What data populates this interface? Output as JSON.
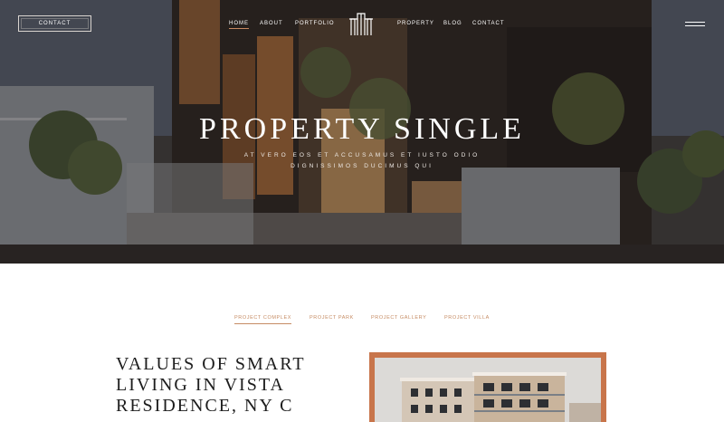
{
  "header": {
    "contact_label": "CONTACT",
    "nav": [
      {
        "label": "HOME",
        "active": true
      },
      {
        "label": "ABOUT",
        "active": false
      },
      {
        "label": "PORTFOLIO",
        "active": false
      },
      {
        "label": "PROPERTY",
        "active": false
      },
      {
        "label": "BLOG",
        "active": false
      },
      {
        "label": "CONTACT",
        "active": false
      }
    ],
    "logo_icon": "building-logo-icon",
    "menu_icon": "hamburger-icon"
  },
  "hero": {
    "title": "PROPERTY SINGLE",
    "subtitle_line1": "AT VERO EOS ET ACCUSAMUS ET IUSTO ODIO",
    "subtitle_line2": "DIGNISSIMOS DUCIMUS QUI"
  },
  "tabs": [
    {
      "label": "PROJECT COMPLEX",
      "active": true
    },
    {
      "label": "PROJECT PARK",
      "active": false
    },
    {
      "label": "PROJECT GALLERY",
      "active": false
    },
    {
      "label": "PROJECT VILLA",
      "active": false
    }
  ],
  "section": {
    "title_line1": "VALUES OF SMART",
    "title_line2": "LIVING IN VISTA",
    "title_line3": "RESIDENCE, NY C"
  },
  "colors": {
    "accent": "#c68c64",
    "frame": "#c8754b"
  }
}
